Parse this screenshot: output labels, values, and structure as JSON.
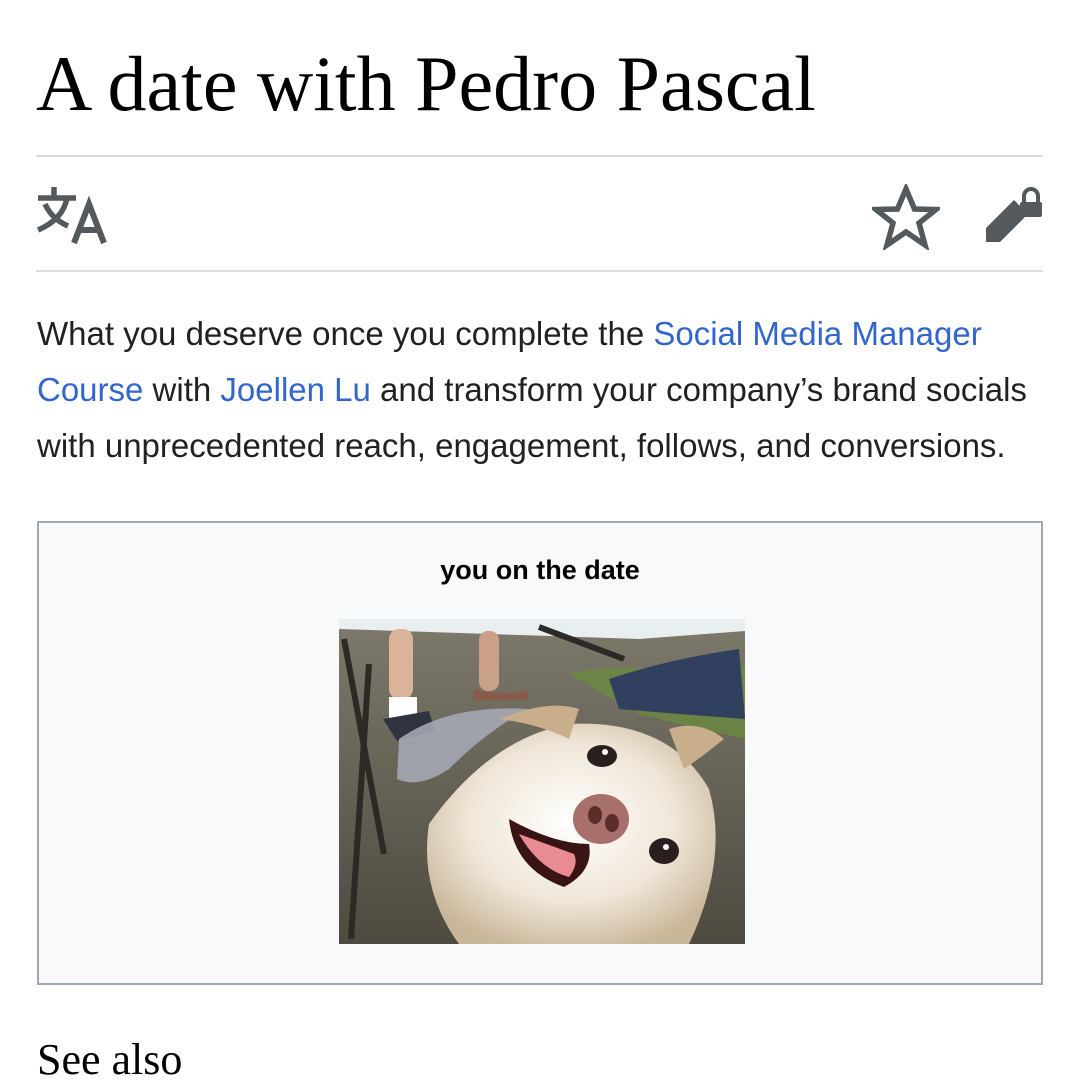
{
  "page": {
    "title": "A date with Pedro Pascal"
  },
  "toolbar": {
    "icons": [
      "language-icon",
      "star-icon",
      "edit-lock-icon"
    ]
  },
  "intro": {
    "text_before": "What you deserve once you complete the ",
    "link_course": "Social Media Manager Course",
    "text_middle": " with ",
    "link_person": "Joellen Lu",
    "text_after": " and transform your company’s brand socials with unprecedented reach, engagement, follows, and conversions."
  },
  "figure": {
    "caption": "you on the date"
  },
  "sections": {
    "see_also": "See also"
  },
  "colors": {
    "link": "#3366cc",
    "text": "#202122",
    "icon": "#54595d",
    "rule": "#dadde3",
    "figure_bg": "#f8f9fa",
    "figure_border": "#a2a9b1"
  }
}
